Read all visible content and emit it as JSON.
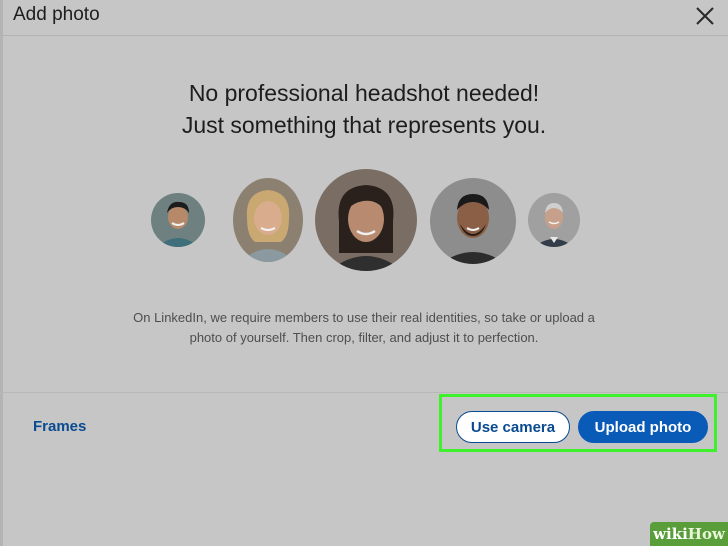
{
  "dialog": {
    "title": "Add photo",
    "close_icon": "close-icon"
  },
  "main": {
    "headline_line1": "No professional headshot needed!",
    "headline_line2": "Just something that represents you.",
    "description_line1": "On LinkedIn, we require members to use their real identities, so take or upload a",
    "description_line2": "photo of yourself. Then crop, filter, and adjust it to perfection."
  },
  "footer": {
    "frames_label": "Frames",
    "use_camera_label": "Use camera",
    "upload_photo_label": "Upload photo"
  },
  "watermark": {
    "wiki": "wiki",
    "how": "How"
  },
  "colors": {
    "brand_blue": "#0a5ab8",
    "link_blue": "#0a4a91",
    "highlight_green": "#3ff12c",
    "overlay_gray": "#c6c6c6"
  }
}
